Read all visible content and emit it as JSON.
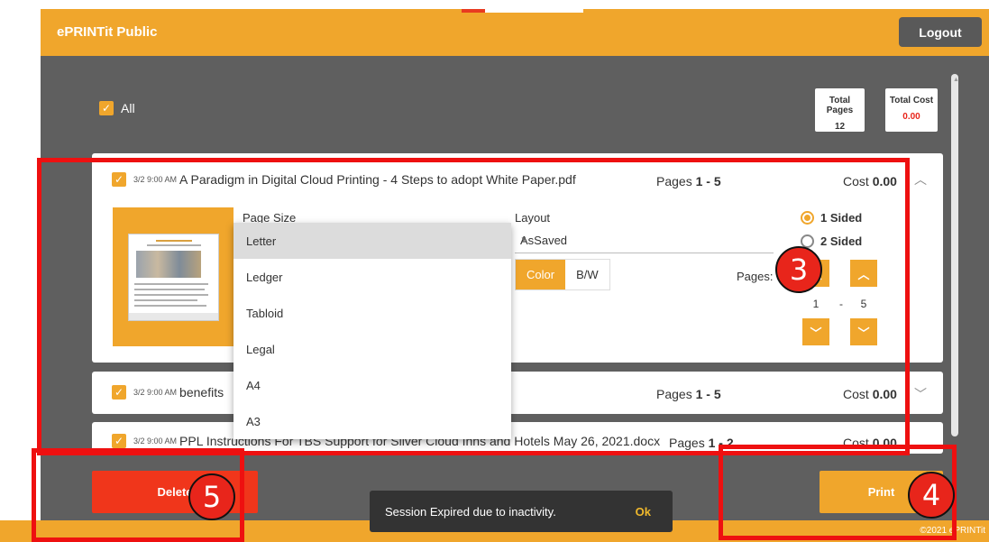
{
  "app": {
    "title": "ePRINTit Public",
    "logout_label": "Logout"
  },
  "all_label": "All",
  "totals": {
    "pages_label": "Total Pages",
    "pages_value": "12",
    "cost_label": "Total Cost",
    "cost_value": "0.00"
  },
  "files": [
    {
      "timestamp": "3/2 9:00 AM",
      "name": "A Paradigm in Digital Cloud Printing - 4 Steps to adopt White Paper.pdf",
      "pages_prefix": "Pages ",
      "pages_range": "1 - 5",
      "cost_prefix": "Cost ",
      "cost_value": "0.00"
    },
    {
      "timestamp": "3/2 9:00 AM",
      "name": "benefits",
      "pages_prefix": "Pages ",
      "pages_range": "1 - 5",
      "cost_prefix": "Cost ",
      "cost_value": "0.00"
    },
    {
      "timestamp": "3/2 9:00 AM",
      "name": "PPL Instructions For TBS Support for Silver Cloud Inns and Hotels May 26, 2021.docx",
      "pages_prefix": "Pages ",
      "pages_range": "1 - 2",
      "cost_prefix": "Cost ",
      "cost_value": "0.00"
    }
  ],
  "options": {
    "page_size_label": "Page Size",
    "page_sizes": [
      "Letter",
      "Ledger",
      "Tabloid",
      "Legal",
      "A4",
      "A3"
    ],
    "layout_label": "Layout",
    "layout_value": "AsSaved",
    "color_label": "Color",
    "bw_label": "B/W",
    "one_sided": "1 Sided",
    "two_sided": "2 Sided",
    "pages_label": "Pages:",
    "range_from": "1",
    "range_sep": "-",
    "range_to": "5"
  },
  "actions": {
    "delete_label": "Delete",
    "print_label": "Print"
  },
  "snackbar": {
    "message": "Session Expired due to inactivity.",
    "ok_label": "Ok"
  },
  "footer": "©2021 ePRINTit",
  "annotations": {
    "badge_3": "3",
    "badge_4": "4",
    "badge_5": "5"
  },
  "colors": {
    "accent": "#f0a62c",
    "danger": "#f0361b",
    "cost_red": "#e8251b",
    "annotation_red": "#ee1010"
  }
}
